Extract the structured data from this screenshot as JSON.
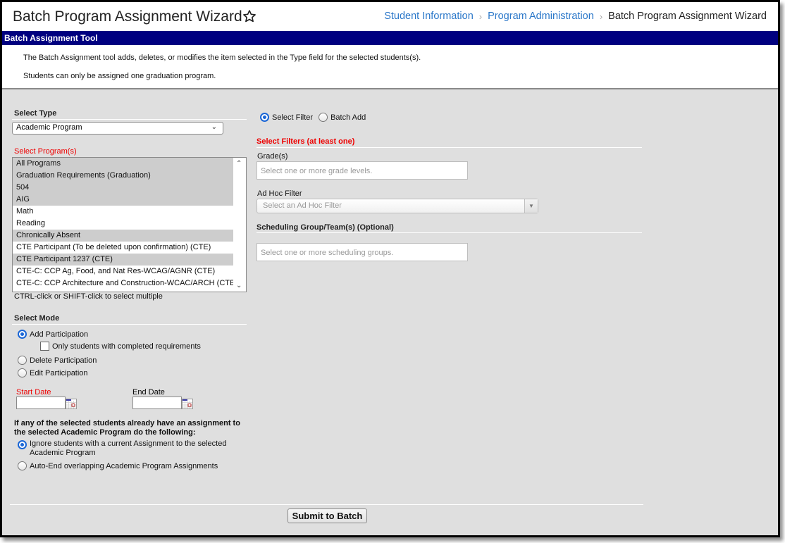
{
  "header": {
    "title": "Batch Program Assignment Wizard",
    "favorite_icon": "star-outline-icon",
    "breadcrumb": [
      {
        "label": "Student Information",
        "link": true
      },
      {
        "label": "Program Administration",
        "link": true
      },
      {
        "label": "Batch Program Assignment Wizard",
        "link": false
      }
    ],
    "separator": "›"
  },
  "banner": {
    "title": "Batch Assignment Tool"
  },
  "intro": {
    "line1": "The Batch Assignment tool adds, deletes, or modifies the item selected in the Type field for the selected students(s).",
    "line2": "Students can only be assigned one graduation program."
  },
  "left": {
    "select_type": {
      "heading": "Select Type",
      "value": "Academic Program"
    },
    "programs": {
      "label": "Select Program(s)",
      "options": [
        {
          "label": "All Programs",
          "selected": true
        },
        {
          "label": "Graduation Requirements (Graduation)",
          "selected": true
        },
        {
          "label": "504",
          "selected": true
        },
        {
          "label": "AIG",
          "selected": true
        },
        {
          "label": "Math",
          "selected": false
        },
        {
          "label": "Reading",
          "selected": false
        },
        {
          "label": "Chronically Absent",
          "selected": true
        },
        {
          "label": "CTE Participant (To be deleted upon confirmation) (CTE)",
          "selected": false
        },
        {
          "label": "CTE Participant 1237 (CTE)",
          "selected": true
        },
        {
          "label": "CTE-C: CCP Ag, Food, and Nat Res-WCAG/AGNR (CTE)",
          "selected": false
        },
        {
          "label": "CTE-C: CCP Architecture and Construction-WCAC/ARCH (CTE)",
          "selected": false
        }
      ],
      "hint": "CTRL-click or SHIFT-click to select multiple"
    },
    "mode": {
      "heading": "Select Mode",
      "options": [
        {
          "label": "Add Participation",
          "checked": true
        },
        {
          "label": "Delete Participation",
          "checked": false
        },
        {
          "label": "Edit Participation",
          "checked": false
        }
      ],
      "completed_checkbox": {
        "label": "Only students with completed requirements",
        "checked": false
      }
    },
    "dates": {
      "start_label": "Start Date",
      "start_value": "",
      "end_label": "End Date",
      "end_value": ""
    },
    "existing": {
      "heading": "If any of the selected students already have an assignment to the selected Academic Program do the following:",
      "options": [
        {
          "label": "Ignore students with a current Assignment to the selected Academic Program",
          "checked": true
        },
        {
          "label": "Auto-End overlapping Academic Program Assignments",
          "checked": false
        }
      ]
    }
  },
  "right": {
    "filter_mode": [
      {
        "label": "Select Filter",
        "checked": true
      },
      {
        "label": "Batch Add",
        "checked": false
      }
    ],
    "filters_heading": "Select Filters (at least one)",
    "grades": {
      "label": "Grade(s)",
      "placeholder": "Select one or more grade levels."
    },
    "adhoc": {
      "label": "Ad Hoc Filter",
      "placeholder": "Select an Ad Hoc Filter"
    },
    "scheduling": {
      "heading": "Scheduling Group/Team(s) (Optional)",
      "placeholder": "Select one or more scheduling groups."
    }
  },
  "footer": {
    "submit_label": "Submit to Batch"
  },
  "colors": {
    "banner": "#000080",
    "link": "#2a77c9",
    "required": "#e00000",
    "radio_accent": "#1a66d6",
    "selected_option": "#cdcdcd",
    "panel": "#dfdfdf"
  }
}
